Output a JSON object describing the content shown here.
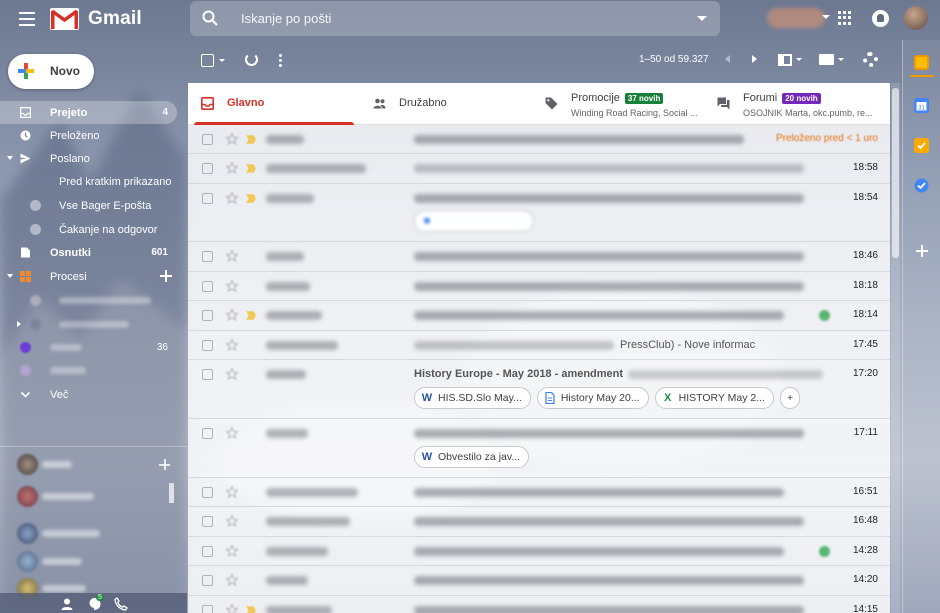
{
  "header": {
    "app_name": "Gmail",
    "search_placeholder": "Iskanje po pošti"
  },
  "sidebar": {
    "compose_label": "Novo",
    "items": [
      {
        "label": "Prejeto",
        "count": "4"
      },
      {
        "label": "Preloženo"
      },
      {
        "label": "Poslano"
      },
      {
        "label": "Pred kratkim prikazano"
      },
      {
        "label": "Vse Bager E-pošta"
      },
      {
        "label": "Čakanje na odgovor"
      },
      {
        "label": "Osnutki",
        "count": "601"
      },
      {
        "label": "Procesi"
      },
      {
        "count": "36"
      },
      {
        "label": "Več"
      }
    ]
  },
  "toolbar": {
    "pagination": "1–50 od 59.327"
  },
  "tabs": [
    {
      "label": "Glavno"
    },
    {
      "label": "Družabno"
    },
    {
      "label": "Promocije",
      "badge": "37 novih",
      "sub": "Winding Road Racing, Social ..."
    },
    {
      "label": "Forumi",
      "badge": "20 novih",
      "sub": "OSOJNIK Marta, okc.pumb, re..."
    }
  ],
  "rows": [
    {
      "snooze": "Preloženo pred < 1 uro"
    },
    {
      "time": "18:58"
    },
    {
      "time": "18:54"
    },
    {
      "time": "18:46"
    },
    {
      "time": "18:18"
    },
    {
      "time": "18:14"
    },
    {
      "time": "17:45",
      "text_end": "PressClub) - Nove informac"
    },
    {
      "time": "17:20",
      "subject": "History Europe - May 2018 - amendment"
    },
    {
      "time": "17:11"
    },
    {
      "time": "16:51"
    },
    {
      "time": "16:48"
    },
    {
      "time": "14:28"
    },
    {
      "time": "14:20"
    },
    {
      "time": "14:15"
    }
  ],
  "attachments": {
    "row8": [
      "HIS.SD.Slo May...",
      "History May 20...",
      "HISTORY May 2..."
    ],
    "row9": [
      "Obvestilo za jav..."
    ],
    "more": "+"
  },
  "colors": {
    "accent_red": "#d93025",
    "promo_badge": "#188038",
    "forum_badge": "#7627bb"
  },
  "icons": [
    "menu-icon",
    "search-icon",
    "apps-icon",
    "notification-icon",
    "refresh-icon",
    "settings-icon",
    "inbox-icon",
    "clock-icon",
    "send-icon",
    "label-icon",
    "people-icon",
    "tag-icon",
    "forum-icon",
    "word-doc-icon",
    "google-doc-icon",
    "excel-icon"
  ]
}
